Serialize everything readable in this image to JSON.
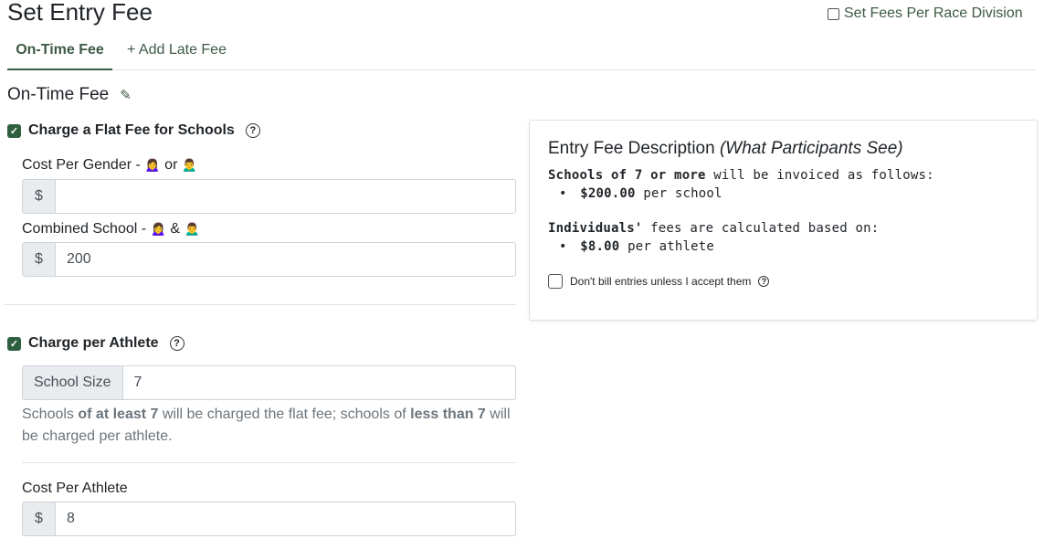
{
  "page": {
    "title": "Set Entry Fee"
  },
  "division_toggle": {
    "label": "Set Fees Per Race Division",
    "checked": false
  },
  "tabs": {
    "active": "On-Time Fee",
    "add": "+ Add Late Fee"
  },
  "section": {
    "heading": "On-Time Fee"
  },
  "flat_fee": {
    "label": "Charge a Flat Fee for Schools",
    "checked": true,
    "cost_per_gender": {
      "label_prefix": "Cost Per Gender - ",
      "conn": "or",
      "addon": "$",
      "value": ""
    },
    "combined": {
      "label_prefix": "Combined School - ",
      "conn": "&",
      "addon": "$",
      "value": "200"
    }
  },
  "per_athlete": {
    "label": "Charge per Athlete",
    "checked": true,
    "school_size": {
      "addon": "School Size",
      "value": "7"
    },
    "help": {
      "p1": "Schools ",
      "b1": "of at least 7",
      "p2": " will be charged the flat fee; schools of ",
      "b2": "less than 7",
      "p3": " will be charged per athlete."
    },
    "cost": {
      "label": "Cost Per Athlete",
      "addon": "$",
      "value": "8"
    }
  },
  "description_card": {
    "title": "Entry Fee Description",
    "title_italic": "(What Participants See)",
    "line1_bold": "Schools of 7 or more",
    "line1_rest": " will be invoiced as follows:",
    "bullet1_bold": "$200.00",
    "bullet1_rest": " per school",
    "line2_bold": "Individuals'",
    "line2_rest": " fees are calculated based on:",
    "bullet2_bold": "$8.00",
    "bullet2_rest": " per athlete",
    "accept_label": "Don't bill entries unless I accept them",
    "accept_checked": false
  },
  "icons": {
    "female": "female-person-icon",
    "male": "male-person-icon",
    "help": "question-circle-icon",
    "pencil": "pencil-icon"
  },
  "colors": {
    "accent": "#3d5a45",
    "checkbox": "#2f5f3f"
  }
}
